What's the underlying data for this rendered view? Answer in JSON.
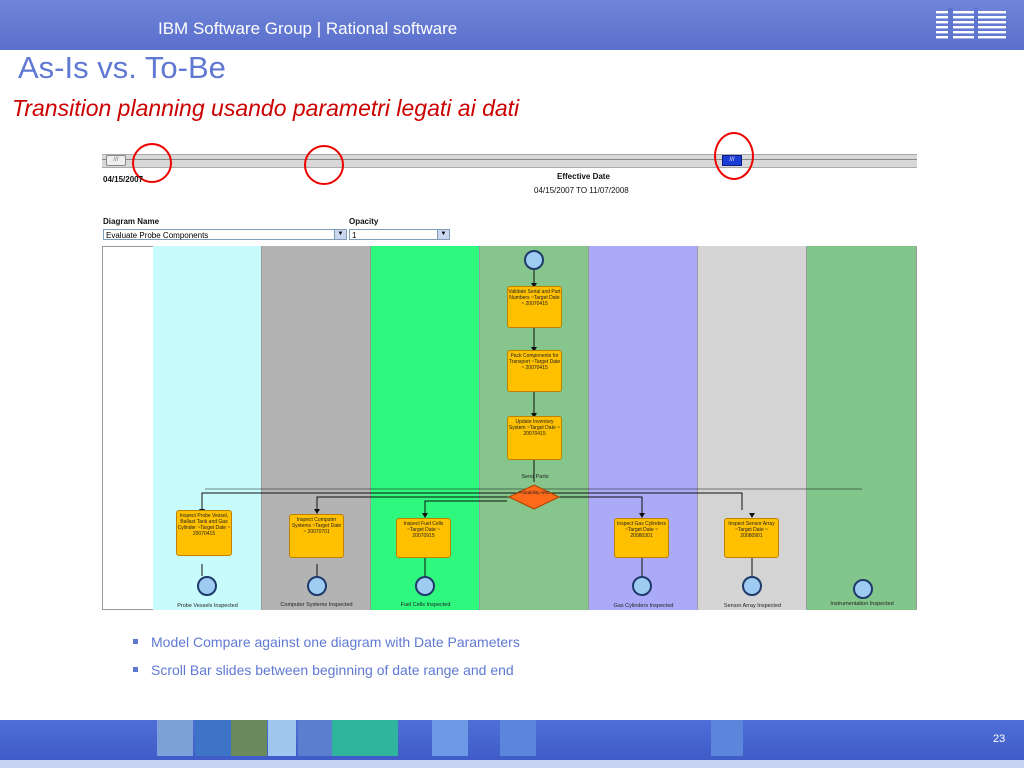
{
  "header": {
    "title": "IBM Software Group | Rational software",
    "logo": "IBM"
  },
  "slide": {
    "title": "As-Is vs. To-Be",
    "subtitle": "Transition planning usando parametri legati ai dati",
    "page_number": "23"
  },
  "screenshot": {
    "start_date": "04/15/2007",
    "effective_date_label": "Effective Date",
    "effective_date_range": "04/15/2007 TO 11/07/2008",
    "diagram_name_label": "Diagram Name",
    "diagram_name_value": "Evaluate Probe Components",
    "opacity_label": "Opacity",
    "opacity_value": "1",
    "nodes": {
      "validate": "Validate Serial and Part Numbers ~Target Date ~ 20070415",
      "pack": "Pack Components for Transport ~Target Date ~ 20070415",
      "update": "Update Inventory System ~Target Date ~ 20070415",
      "send": "Send Parts",
      "gateway": "Probability AND",
      "inspect_probe": "Inspect Probe Vessel, Ballast Tank and Gas Cylinder ~Target Date ~ 20070415",
      "inspect_computer": "Inspect Computer Systems ~Target Date ~ 20070701",
      "inspect_fuel": "Inspect Fuel Cells ~Target Date ~ 20070915",
      "inspect_gas": "Inspect Gas Cylinders ~Target Date ~ 20080301",
      "inspect_sensor": "Inspect Sensor Array ~Target Date ~ 20080901"
    },
    "lane_labels": {
      "probe": "Probe Vessels Inspected",
      "computer": "Computer Systems Inspected",
      "fuel": "Fuel Cells Inspected",
      "gas": "Gas Cylinders Inspected",
      "sensor": "Sensor Array Inspected",
      "instrumentation": "Instrumentation Inspected"
    }
  },
  "bullets": [
    "Model Compare against one diagram with Date Parameters",
    "Scroll Bar slides between beginning of date range and end"
  ],
  "colors": {
    "header_blue": "#6f86d8",
    "title_blue": "#5f79d3",
    "subtitle_red": "#cc0000",
    "highlight_circle": "#ee0000",
    "task_node": "#ffc000"
  }
}
